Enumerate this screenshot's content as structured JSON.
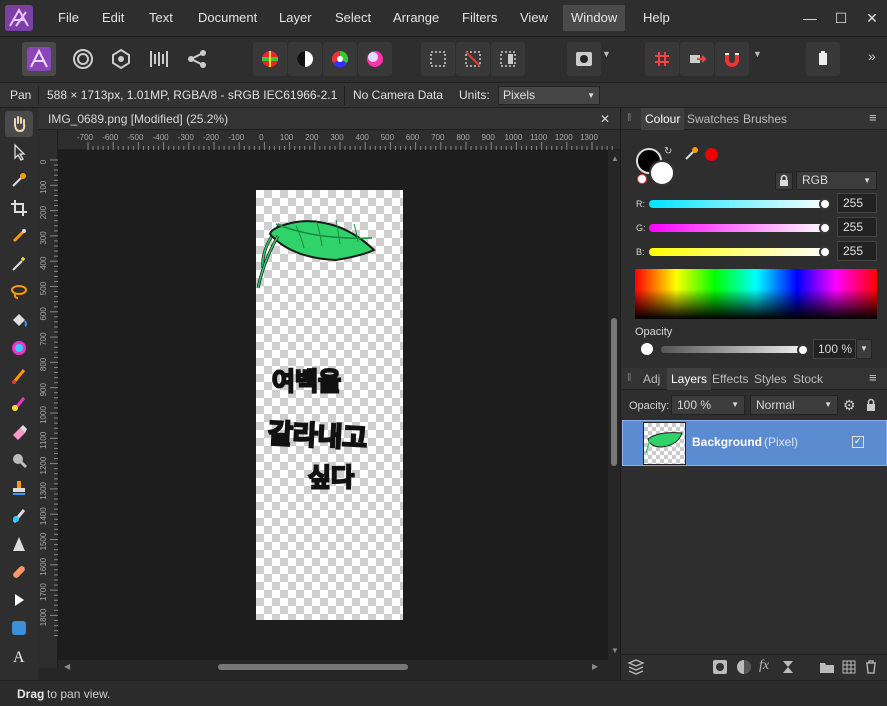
{
  "menubar": {
    "items": [
      "File",
      "Edit",
      "Text",
      "Document",
      "Layer",
      "Select",
      "Arrange",
      "Filters",
      "View",
      "Window",
      "Help"
    ],
    "active": "Window",
    "minimize": "—",
    "maximize": "☐",
    "close": "✕"
  },
  "context": {
    "tool": "Pan",
    "info": "588 × 1713px, 1.01MP, RGBA/8 - sRGB IEC61966-2.1",
    "camera": "No Camera Data",
    "units_label": "Units:",
    "units_value": "Pixels"
  },
  "document": {
    "tab_title": "IMG_0689.png [Modified] (25.2%)",
    "close": "✕",
    "ruler_unit": "px",
    "ruler_top": [
      "-700",
      "-600",
      "-500",
      "-400",
      "-300",
      "-200",
      "-100",
      "0",
      "100",
      "200",
      "300",
      "400",
      "500",
      "600",
      "700",
      "800",
      "900",
      "1000",
      "1100",
      "1200",
      "1300"
    ],
    "ruler_left": [
      "0",
      "100",
      "200",
      "300",
      "400",
      "500",
      "600",
      "700",
      "800",
      "900",
      "1000",
      "1100",
      "1200",
      "1300",
      "1400",
      "1500",
      "1600",
      "1700",
      "1800"
    ],
    "text_lines": [
      "여백을",
      "갈라내고",
      "싶다"
    ]
  },
  "colour_panel": {
    "tabs": [
      "Colour",
      "Swatches",
      "Brushes"
    ],
    "active_tab": "Colour",
    "model": "RGB",
    "channels": [
      {
        "label": "R:",
        "value": "255",
        "color": "#00e5ff"
      },
      {
        "label": "G:",
        "value": "255",
        "color": "#ff00ff"
      },
      {
        "label": "B:",
        "value": "255",
        "color": "#ffff00"
      }
    ],
    "opacity_label": "Opacity",
    "opacity_value": "100 %"
  },
  "layers_panel": {
    "tabs": [
      "Adj",
      "Layers",
      "Effects",
      "Styles",
      "Stock"
    ],
    "active_tab": "Layers",
    "opacity_label": "Opacity:",
    "opacity_value": "100 %",
    "blend_mode": "Normal",
    "layers": [
      {
        "name": "Background",
        "type": "(Pixel)",
        "visible": true,
        "selected": true
      }
    ]
  },
  "status": {
    "bold": "Drag",
    "text": " to pan view."
  }
}
